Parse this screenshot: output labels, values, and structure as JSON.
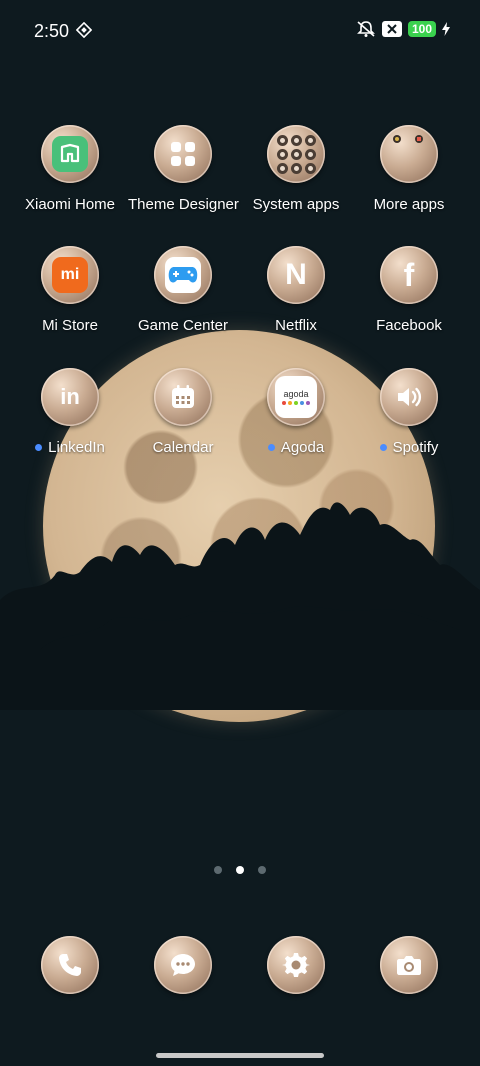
{
  "status_bar": {
    "time": "2:50",
    "battery": "100"
  },
  "apps": [
    {
      "label": "Xiaomi Home",
      "icon": "xiaomi-home-icon",
      "dot": false
    },
    {
      "label": "Theme Designer",
      "icon": "theme-designer-icon",
      "dot": false
    },
    {
      "label": "System apps",
      "icon": "system-apps-folder-icon",
      "dot": false
    },
    {
      "label": "More apps",
      "icon": "more-apps-folder-icon",
      "dot": false
    },
    {
      "label": "Mi Store",
      "icon": "mi-store-icon",
      "badge": "mi",
      "dot": false
    },
    {
      "label": "Game Center",
      "icon": "game-center-icon",
      "dot": false
    },
    {
      "label": "Netflix",
      "icon": "netflix-icon",
      "letter": "N",
      "dot": false
    },
    {
      "label": "Facebook",
      "icon": "facebook-icon",
      "letter": "f",
      "dot": false
    },
    {
      "label": "LinkedIn",
      "icon": "linkedin-icon",
      "letter": "in",
      "dot": true
    },
    {
      "label": "Calendar",
      "icon": "calendar-icon",
      "dot": false
    },
    {
      "label": "Agoda",
      "icon": "agoda-icon",
      "brand": "agoda",
      "dot": true
    },
    {
      "label": "Spotify",
      "icon": "spotify-icon",
      "dot": true
    }
  ],
  "dock": [
    {
      "icon": "phone-icon"
    },
    {
      "icon": "messages-icon"
    },
    {
      "icon": "settings-icon"
    },
    {
      "icon": "camera-icon"
    }
  ],
  "pager": {
    "pages": 3,
    "active": 2
  },
  "colors": {
    "background": "#0e1a1f",
    "icon_bronze": "#c9ab92",
    "battery_green": "#3ad14e",
    "notification_dot": "#4a8cff"
  }
}
